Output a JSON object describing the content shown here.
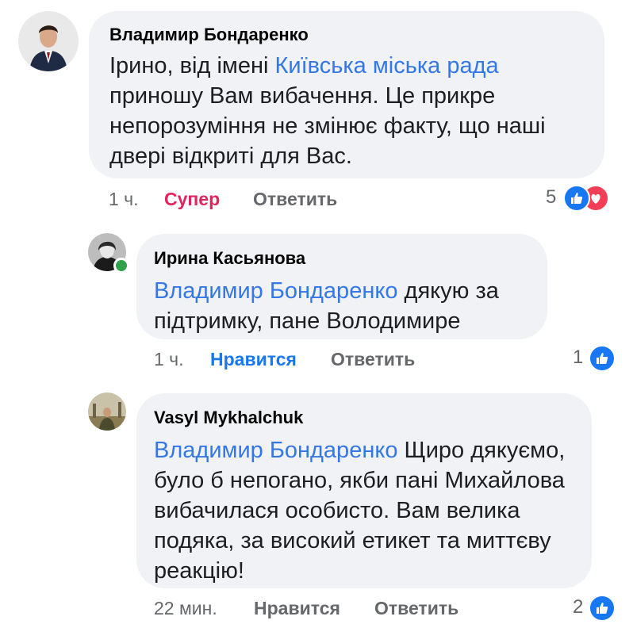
{
  "comments": [
    {
      "author": "Владимир Бондаренко",
      "text_before": "Ірино, від імені ",
      "mention": "Київська міська рада",
      "text_after": " приношу Вам вибачення. Це прикре непорозуміння не змінює факту, що наші двері відкриті для Вас.",
      "time": "1 ч.",
      "like_label": "Супер",
      "reply_label": "Ответить",
      "reaction_count": "5",
      "reactions": [
        "like-icon",
        "love-icon"
      ]
    },
    {
      "author": "Ирина Касьянова",
      "mention": "Владимир Бондаренко",
      "text_after": " дякую за підтримку, пане Володимире",
      "time": "1 ч.",
      "like_label": "Нравится",
      "reply_label": "Ответить",
      "reaction_count": "1",
      "reactions": [
        "like-icon"
      ],
      "online": true
    },
    {
      "author": "Vasyl Mykhalchuk",
      "mention": "Владимир Бондаренко",
      "text_after": " Щиро дякуємо, було б непогано, якби пані Михайлова вибачилася особисто. Вам велика подяка, за високий етикет та миттєву реакцію!",
      "time": "22 мин.",
      "like_label": "Нравится",
      "reply_label": "Ответить",
      "reaction_count": "2",
      "reactions": [
        "like-icon"
      ]
    }
  ],
  "colors": {
    "bubble": "#f0f2f5",
    "mention": "#3578e5",
    "super": "#e0245e",
    "like_blue": "#1877f2",
    "meta": "#65676b"
  }
}
